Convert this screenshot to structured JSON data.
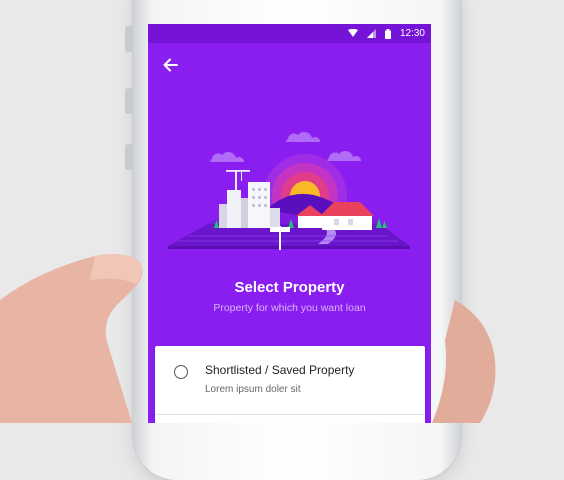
{
  "statusbar": {
    "time": "12:30"
  },
  "icons": {
    "back": "arrow-left-icon",
    "wifi": "wifi-icon",
    "signal": "signal-icon",
    "battery": "battery-icon"
  },
  "colors": {
    "accent": "#8a1ef0",
    "statusbar": "#7513d6",
    "subtitle": "#d7b6fb"
  },
  "page": {
    "title": "Select Property",
    "subtitle": "Property for which you want loan"
  },
  "options": [
    {
      "label": "Shortlisted / Saved Property",
      "description": "Lorem ipsum doler sit",
      "selected": false
    }
  ]
}
